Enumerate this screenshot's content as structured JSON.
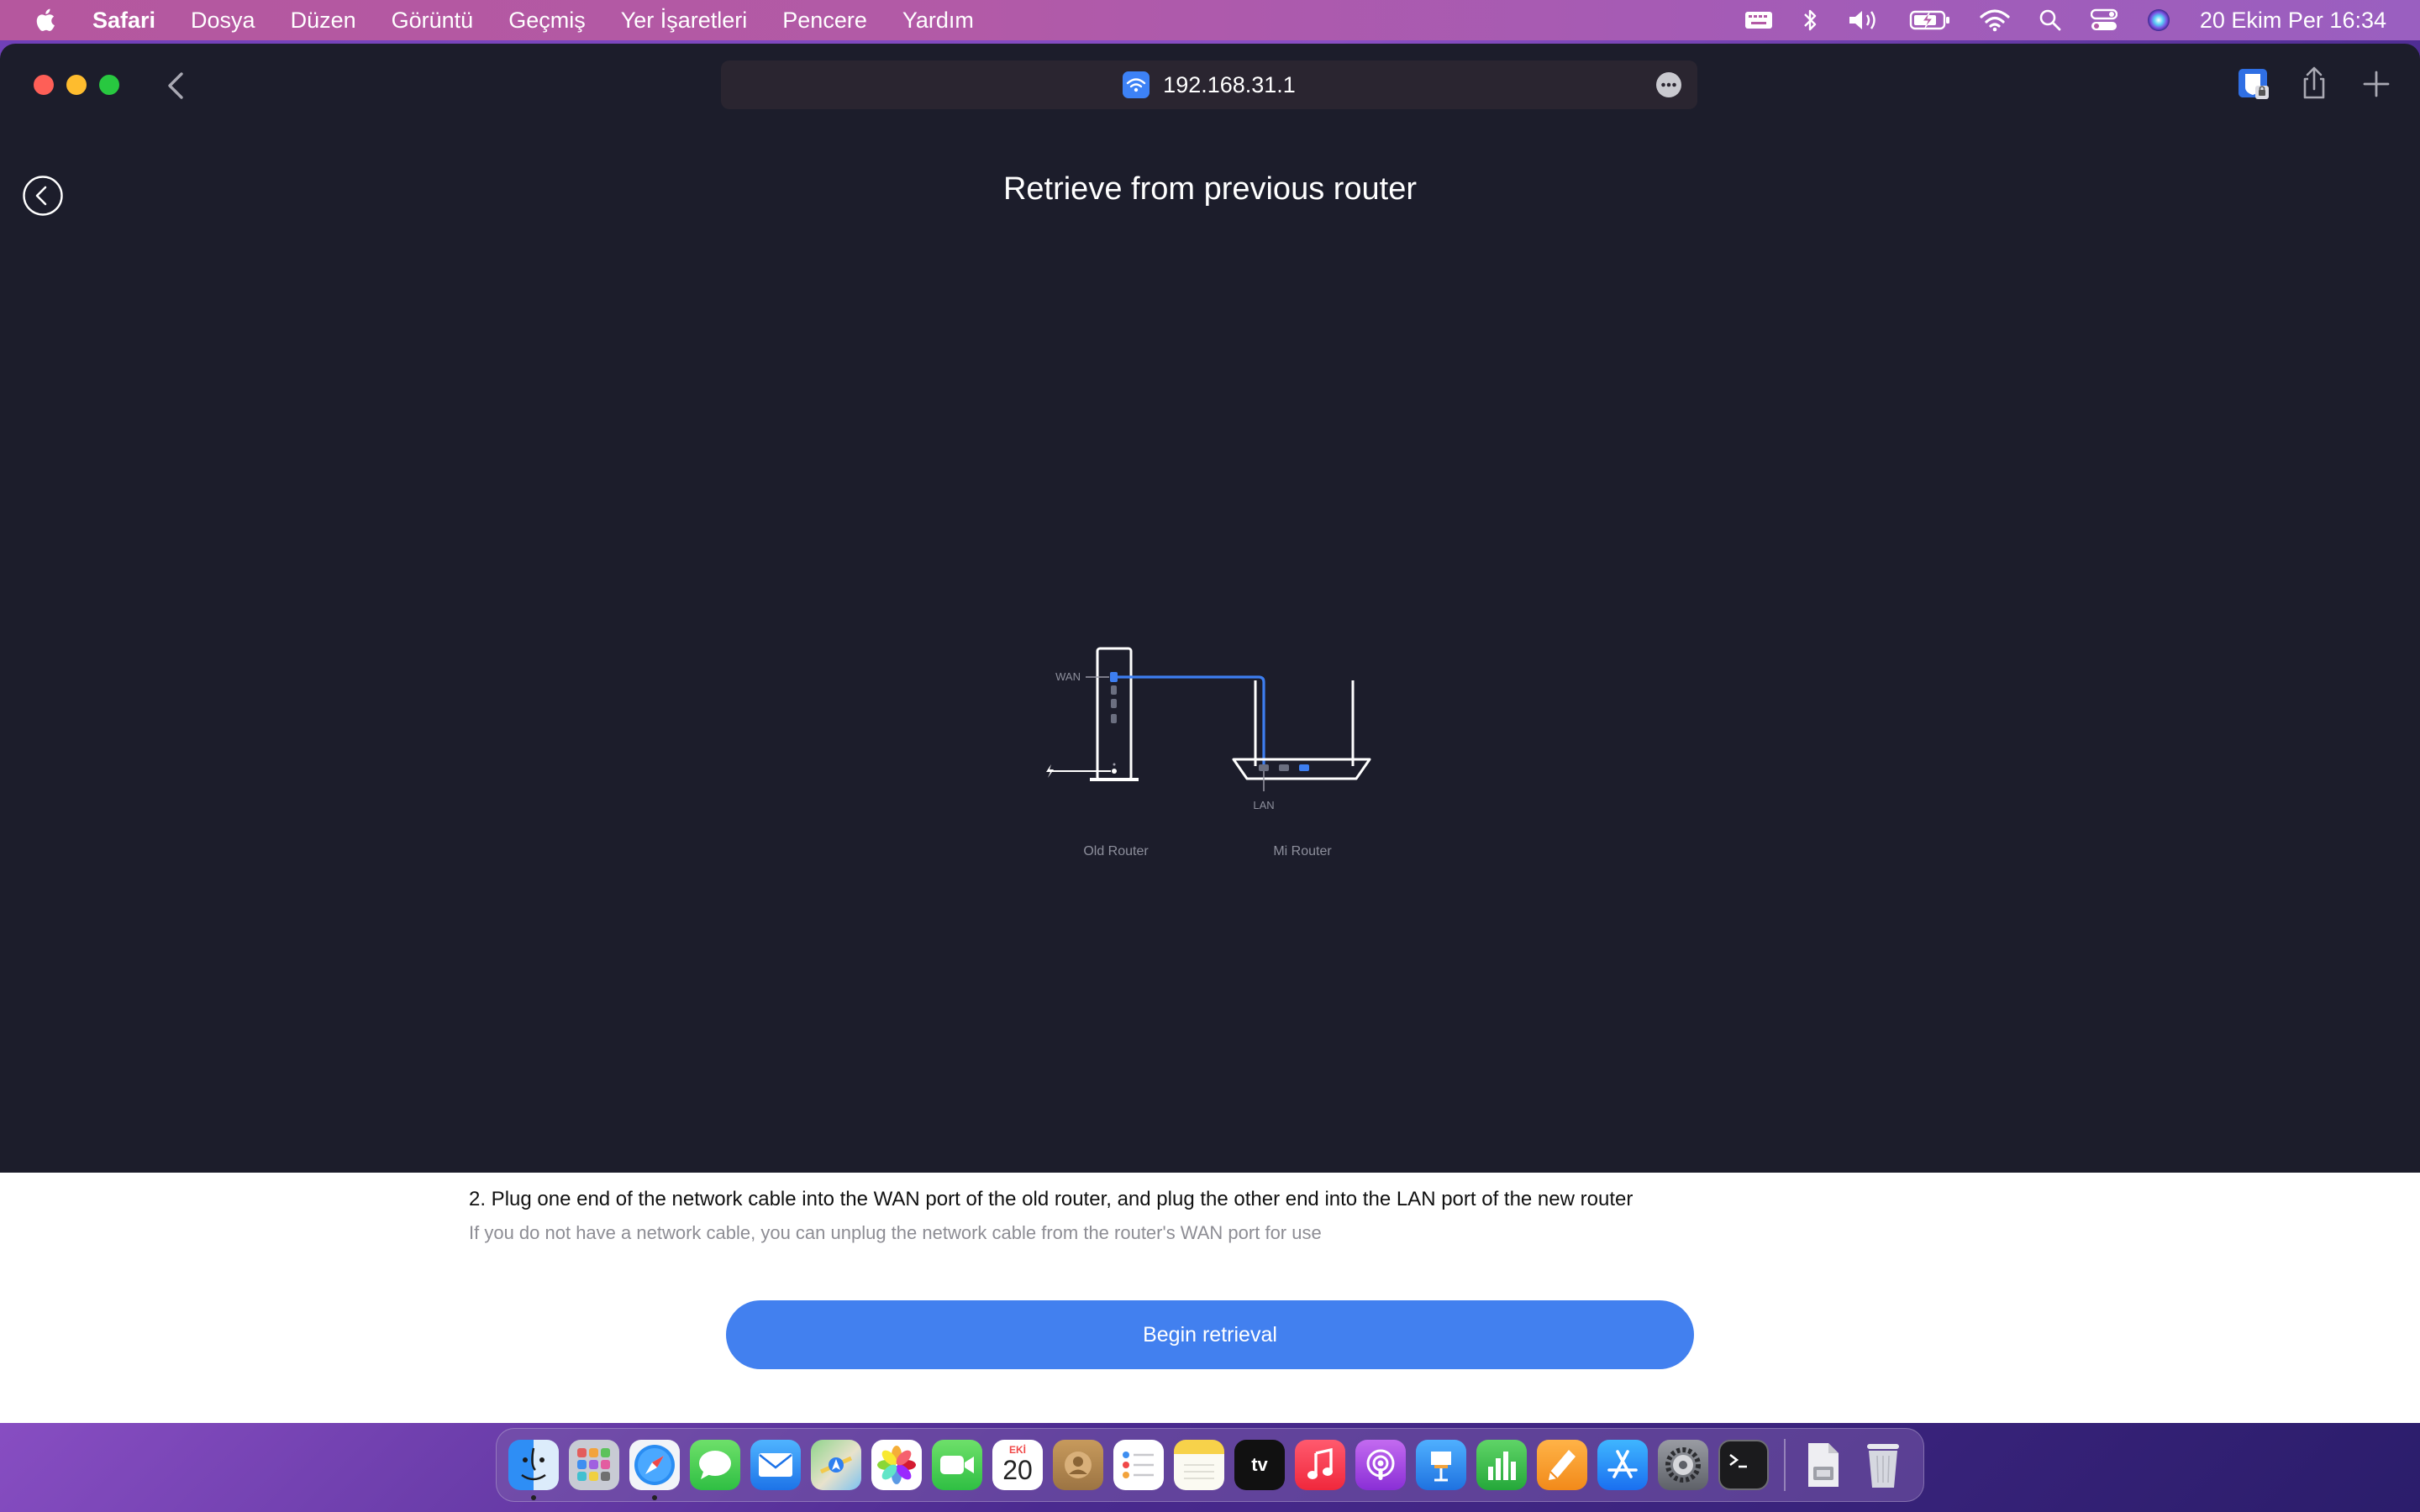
{
  "menubar": {
    "app_name": "Safari",
    "items": [
      "Dosya",
      "Düzen",
      "Görüntü",
      "Geçmiş",
      "Yer İşaretleri",
      "Pencere",
      "Yardım"
    ],
    "clock": "20 Ekim Per  16:34"
  },
  "browser": {
    "url": "192.168.31.1"
  },
  "page": {
    "title": "Retrieve from previous router",
    "diagram": {
      "wan_label": "WAN",
      "lan_label": "LAN",
      "old_router_label": "Old Router",
      "mi_router_label": "Mi Router",
      "cable_color": "#3d7ef0"
    },
    "step_title": "2. Plug one end of the network cable into the WAN port of the old router, and plug the other end into the LAN port of the new router",
    "step_hint": "If you do not have a network cable, you can unplug the network cable from the router's WAN port for use",
    "primary_button": "Begin retrieval"
  },
  "dock": {
    "calendar_month": "EKİ",
    "calendar_day": "20",
    "tv_label": "tv",
    "apps": [
      "finder",
      "launchpad",
      "safari",
      "messages",
      "mail",
      "maps",
      "photos",
      "facetime",
      "calendar",
      "contacts",
      "reminders",
      "notes",
      "tv",
      "music",
      "podcasts",
      "keynote",
      "numbers",
      "pages",
      "app-store",
      "system-settings",
      "terminal",
      "downloads",
      "trash"
    ]
  },
  "colors": {
    "accent": "#4280ef",
    "page_dark_bg": "#1c1d2b",
    "page_light_bg": "#ffffff"
  }
}
